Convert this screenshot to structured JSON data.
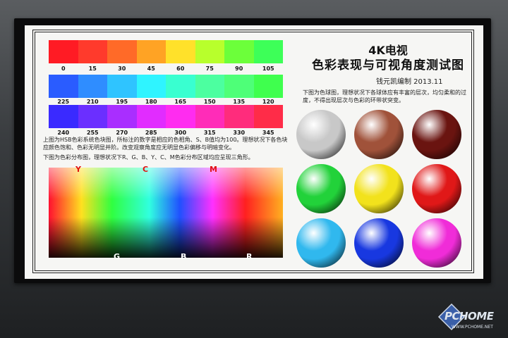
{
  "title_line1": "4K电视",
  "title_line2": "色彩表现与可视角度测试图",
  "author": "钱元凯编制  2013.11",
  "hue_rows": [
    {
      "labels": [
        "0",
        "15",
        "30",
        "45",
        "60",
        "75",
        "90",
        "105"
      ],
      "colors": [
        "#ff1b24",
        "#ff3a2c",
        "#ff6a28",
        "#ffa324",
        "#ffe12a",
        "#b8ff2c",
        "#6cff3a",
        "#3dff58"
      ]
    },
    {
      "labels": [
        "225",
        "210",
        "195",
        "180",
        "165",
        "150",
        "135",
        "120"
      ],
      "colors": [
        "#2a5cff",
        "#2f8dff",
        "#2fc4ff",
        "#2ff4ff",
        "#39ffd0",
        "#4cffa0",
        "#4eff78",
        "#3fff4e"
      ]
    },
    {
      "labels": [
        "240",
        "255",
        "270",
        "285",
        "300",
        "315",
        "330",
        "345"
      ],
      "colors": [
        "#3a2aff",
        "#6b2fff",
        "#a92eff",
        "#e12cff",
        "#ff2cf0",
        "#ff2cb8",
        "#ff2c7c",
        "#ff2c48"
      ]
    }
  ],
  "hsb_note": "上图为HSB色彩系统色块图，所标注的数字是相应的色相角、S、B值均为100。理想状况下各色块应颜色饱和、色彩无明显并阶。改变观察角度应无明显色彩偏移与明暗变化。",
  "dist_note": "下图为色彩分布图，理想状况下R、G、B、Y、C、M色彩分布区域均应呈现三角形。",
  "dist_labels": {
    "y": "Y",
    "c": "C",
    "m": "M",
    "g": "G",
    "b": "B",
    "r": "R"
  },
  "sphere_note": "下图为色球图，理想状况下各球体应有丰富的层次，均匀柔和的过度，不得出现层次与色彩的环带状突变。",
  "spheres": [
    "#c8c8c8",
    "#a0523a",
    "#6a1410",
    "#22d23a",
    "#f2e21c",
    "#e01818",
    "#30b8ee",
    "#1838e0",
    "#f02cd8"
  ],
  "watermark": {
    "brand": "PCHOME",
    "url": "WWW.PCHOME.NET"
  },
  "colors": {
    "label_red": "#e01010",
    "label_white": "#ffffff"
  }
}
